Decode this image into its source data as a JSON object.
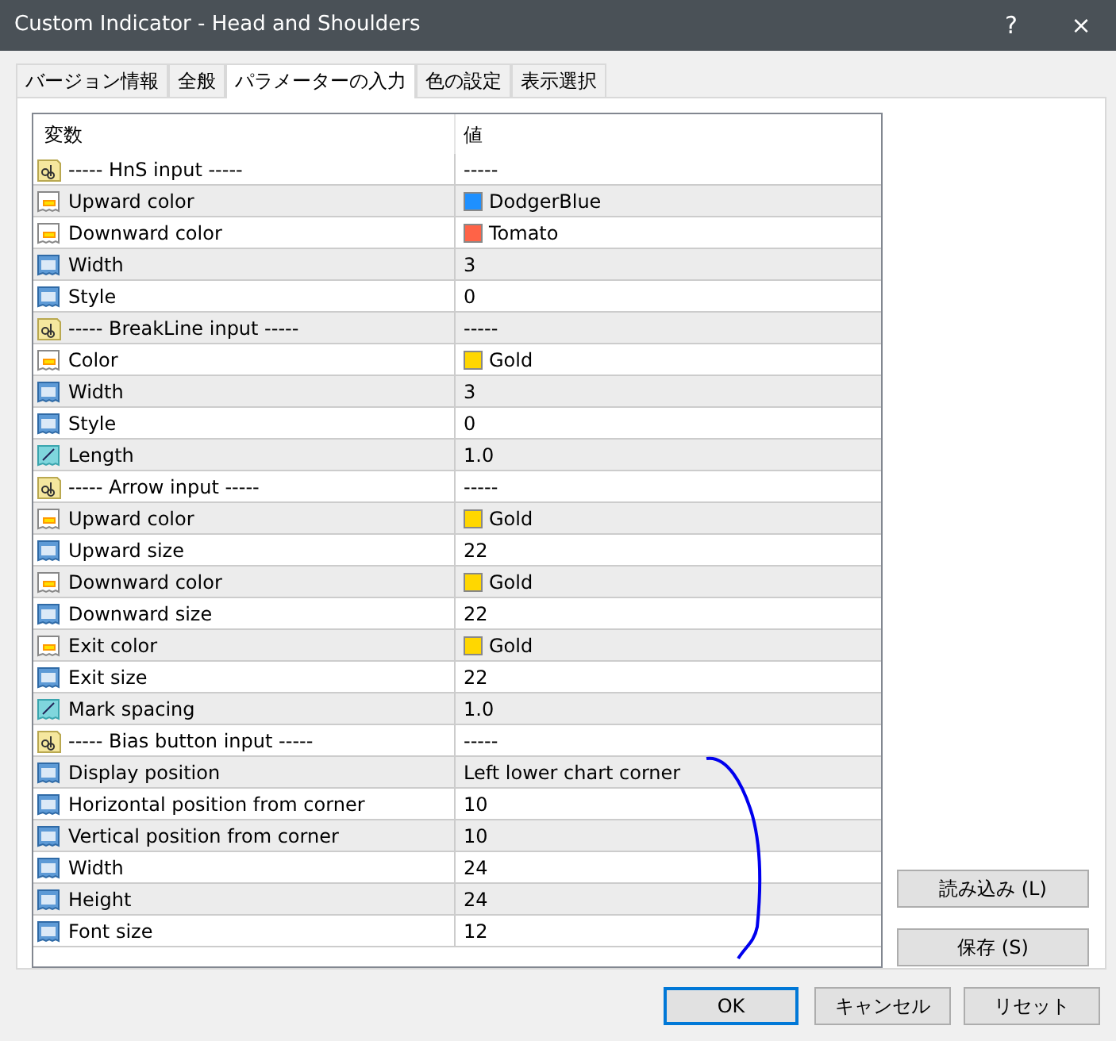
{
  "window": {
    "title": "Custom Indicator - Head and Shoulders",
    "help": "?",
    "close": "×"
  },
  "tabs": [
    {
      "label": "バージョン情報",
      "selected": false
    },
    {
      "label": "全般",
      "selected": false
    },
    {
      "label": "パラメーターの入力",
      "selected": true
    },
    {
      "label": "色の設定",
      "selected": false
    },
    {
      "label": "表示選択",
      "selected": false
    }
  ],
  "table": {
    "columns": [
      "変数",
      "値"
    ],
    "rows": [
      {
        "kind": "string",
        "name": "----- HnS input -----",
        "value": "-----"
      },
      {
        "kind": "color",
        "name": "Upward color",
        "value": "DodgerBlue",
        "color": "#1e90ff"
      },
      {
        "kind": "color",
        "name": "Downward color",
        "value": "Tomato",
        "color": "#ff6347"
      },
      {
        "kind": "int",
        "name": "Width",
        "value": "3"
      },
      {
        "kind": "int",
        "name": "Style",
        "value": "0"
      },
      {
        "kind": "string",
        "name": "----- BreakLine input -----",
        "value": "-----"
      },
      {
        "kind": "color",
        "name": "Color",
        "value": "Gold",
        "color": "#ffd700"
      },
      {
        "kind": "int",
        "name": "Width",
        "value": "3"
      },
      {
        "kind": "int",
        "name": "Style",
        "value": "0"
      },
      {
        "kind": "double",
        "name": "Length",
        "value": "1.0"
      },
      {
        "kind": "string",
        "name": "----- Arrow input -----",
        "value": "-----"
      },
      {
        "kind": "color",
        "name": "Upward color",
        "value": "Gold",
        "color": "#ffd700"
      },
      {
        "kind": "int",
        "name": "Upward size",
        "value": "22"
      },
      {
        "kind": "color",
        "name": "Downward color",
        "value": "Gold",
        "color": "#ffd700"
      },
      {
        "kind": "int",
        "name": "Downward size",
        "value": "22"
      },
      {
        "kind": "color",
        "name": "Exit color",
        "value": "Gold",
        "color": "#ffd700"
      },
      {
        "kind": "int",
        "name": "Exit size",
        "value": "22"
      },
      {
        "kind": "double",
        "name": "Mark spacing",
        "value": "1.0"
      },
      {
        "kind": "string",
        "name": "----- Bias button input -----",
        "value": "-----"
      },
      {
        "kind": "int",
        "name": "Display position",
        "value": "Left lower chart corner"
      },
      {
        "kind": "int",
        "name": "Horizontal position from corner",
        "value": "10"
      },
      {
        "kind": "int",
        "name": "Vertical position from corner",
        "value": "10"
      },
      {
        "kind": "int",
        "name": "Width",
        "value": "24"
      },
      {
        "kind": "int",
        "name": "Height",
        "value": "24"
      },
      {
        "kind": "int",
        "name": "Font size",
        "value": "12"
      }
    ]
  },
  "side_buttons": [
    "読み込み (L)",
    "保存 (S)"
  ],
  "buttons": [
    {
      "label": "OK",
      "default": true
    },
    {
      "label": "キャンセル",
      "default": false
    },
    {
      "label": "リセット",
      "default": false
    }
  ]
}
